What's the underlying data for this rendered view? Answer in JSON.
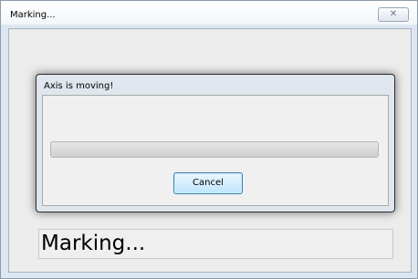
{
  "window": {
    "title": "Marking...",
    "close_glyph": "✕"
  },
  "status": {
    "text": "Marking..."
  },
  "dialog": {
    "title": "Axis is moving!",
    "progress_fraction": 0,
    "cancel_label": "Cancel"
  },
  "colors": {
    "accent": "#3c7fb1",
    "background_shape": "#c84a45"
  }
}
